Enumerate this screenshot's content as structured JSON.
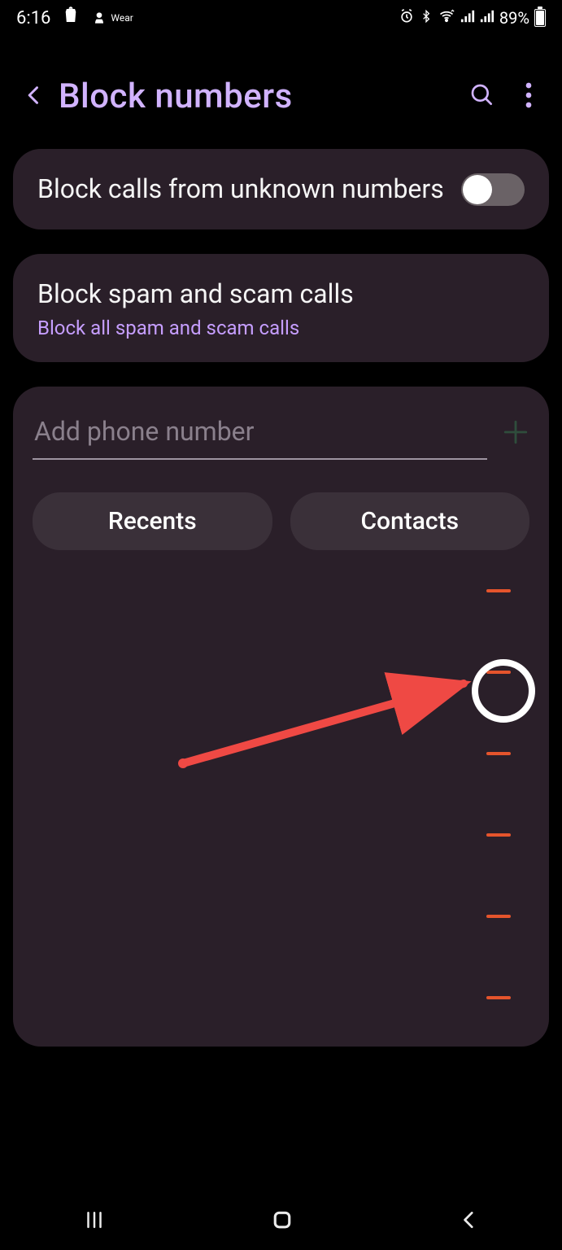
{
  "status_bar": {
    "time": "6:16",
    "wear_label": "Wear",
    "battery_text": "89%"
  },
  "header": {
    "title": "Block numbers"
  },
  "card_unknown": {
    "title": "Block calls from unknown numbers",
    "toggle_on": false
  },
  "card_spam": {
    "title": "Block spam and scam calls",
    "subtitle": "Block all spam and scam calls"
  },
  "add_section": {
    "placeholder": "Add phone number",
    "recents_label": "Recents",
    "contacts_label": "Contacts"
  },
  "blocked_list_count": 6
}
